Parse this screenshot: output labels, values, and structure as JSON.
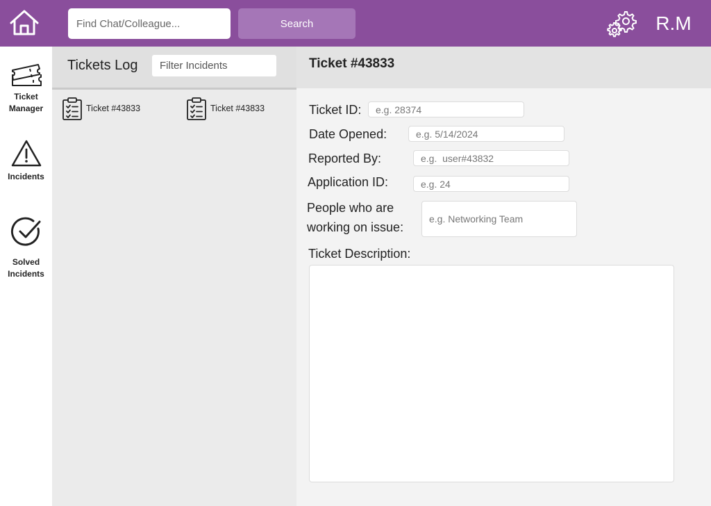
{
  "header": {
    "home_icon": "home-icon",
    "search": {
      "placeholder": "Find Chat/Colleague...",
      "value": ""
    },
    "search_button_label": "Search",
    "settings_icon": "gear-icon",
    "user_initials": "R.M",
    "colors": {
      "bar": "#8a4e9c",
      "button": "#a576b7"
    }
  },
  "sidebar": {
    "items": [
      {
        "label_line1": "Ticket",
        "label_line2": "Manager",
        "icon": "ticket-icon"
      },
      {
        "label_line1": "Incidents",
        "label_line2": "",
        "icon": "warning-icon"
      },
      {
        "label_line1": "Solved",
        "label_line2": "Incidents",
        "icon": "check-circle-icon"
      }
    ]
  },
  "tickets_log": {
    "title": "Tickets Log",
    "filter": {
      "placeholder": "Filter Incidents",
      "value": ""
    },
    "tickets": [
      {
        "label": "Ticket #43833",
        "icon": "clipboard-list-icon"
      },
      {
        "label": "Ticket #43833",
        "icon": "clipboard-list-icon"
      }
    ]
  },
  "ticket_detail": {
    "title": "Ticket #43833",
    "fields": {
      "ticket_id": {
        "label": "Ticket ID:",
        "placeholder": "e.g. 28374",
        "value": ""
      },
      "date_opened": {
        "label": "Date Opened:",
        "placeholder": "e.g. 5/14/2024",
        "value": ""
      },
      "reported_by": {
        "label": "Reported By:",
        "placeholder": "e.g.  user#43832",
        "value": ""
      },
      "application_id": {
        "label": "Application ID:",
        "placeholder": "e.g. 24",
        "value": ""
      },
      "people": {
        "label_line1": "People who are",
        "label_line2": "working on issue:",
        "placeholder": "e.g. Networking Team",
        "value": ""
      }
    },
    "description": {
      "label": "Ticket Description:",
      "value": ""
    }
  }
}
